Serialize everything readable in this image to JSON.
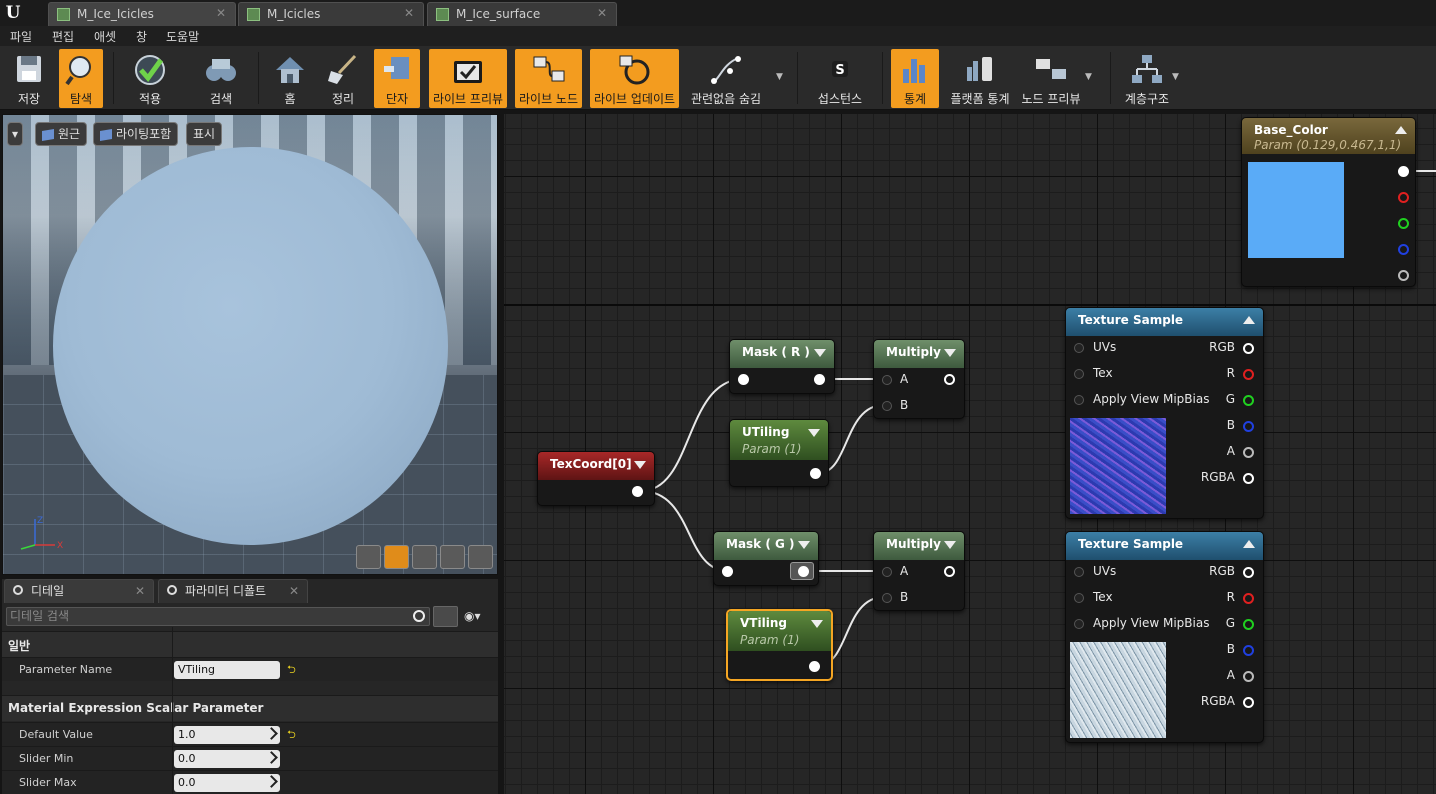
{
  "tabs": [
    {
      "label": "M_Ice_Icicles"
    },
    {
      "label": "M_Icicles"
    },
    {
      "label": "M_Ice_surface"
    }
  ],
  "menu": [
    "파일",
    "편집",
    "애셋",
    "창",
    "도움말"
  ],
  "toolbar": {
    "save": "저장",
    "browse": "탐색",
    "apply": "적용",
    "search": "검색",
    "home": "홈",
    "clean": "정리",
    "hierarchy_toggle": "단자",
    "live_preview": "라이브 프리뷰",
    "live_nodes": "라이브 노드",
    "live_update": "라이브 업데이트",
    "hide_unrelated": "관련없음 숨김",
    "substance": "섭스턴스",
    "stats": "통계",
    "platform_stats": "플랫폼 통계",
    "node_preview": "노드 프리뷰",
    "hierarchy": "계층구조"
  },
  "viewport": {
    "perspective": "원근",
    "lighting": "라이팅포함",
    "show": "표시",
    "axis_z": "Z",
    "axis_x": "X"
  },
  "details": {
    "tab_details": "디테일",
    "tab_param_defaults": "파라미터 디폴트",
    "search_placeholder": "디테일 검색",
    "cat_general": "일반",
    "param_name_label": "Parameter Name",
    "param_name_value": "VTiling",
    "cat_scalar": "Material Expression Scalar Parameter",
    "default_label": "Default Value",
    "default_value": "1.0",
    "slider_min_label": "Slider Min",
    "slider_min_value": "0.0",
    "slider_max_label": "Slider Max",
    "slider_max_value": "0.0"
  },
  "nodes": {
    "base_color": {
      "title": "Base_Color",
      "sub": "Param (0.129,0.467,1,1)",
      "swatch": "#5aabf7"
    },
    "texcoord": {
      "title": "TexCoord[0]"
    },
    "mask_r": {
      "title": "Mask ( R )"
    },
    "mask_g": {
      "title": "Mask ( G )"
    },
    "utiling": {
      "title": "UTiling",
      "sub": "Param (1)"
    },
    "vtiling": {
      "title": "VTiling",
      "sub": "Param (1)"
    },
    "multiply1": {
      "title": "Multiply",
      "a": "A",
      "b": "B"
    },
    "multiply2": {
      "title": "Multiply",
      "a": "A",
      "b": "B"
    },
    "tex1": {
      "title": "Texture Sample",
      "uvs": "UVs",
      "tex": "Tex",
      "mip": "Apply View MipBias",
      "rgb": "RGB",
      "r": "R",
      "g": "G",
      "b": "B",
      "a": "A",
      "rgba": "RGBA"
    },
    "tex2": {
      "title": "Texture Sample",
      "uvs": "UVs",
      "tex": "Tex",
      "mip": "Apply View MipBias",
      "rgb": "RGB",
      "r": "R",
      "g": "G",
      "b": "B",
      "a": "A",
      "rgba": "RGBA"
    }
  },
  "colors": {
    "accent": "#f39c1f",
    "selected": "#f5a623",
    "pin_r": "#e02020",
    "pin_g": "#20d020",
    "pin_b": "#2040e0"
  }
}
